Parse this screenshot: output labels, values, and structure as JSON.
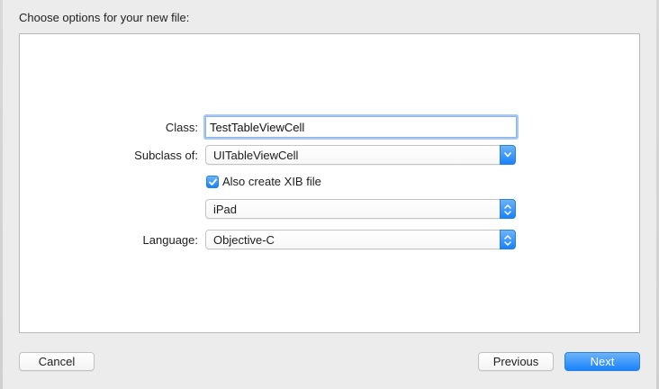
{
  "dialog": {
    "heading": "Choose options for your new file:"
  },
  "form": {
    "class_label": "Class:",
    "class_value": "TestTableViewCell",
    "subclass_label": "Subclass of:",
    "subclass_value": "UITableViewCell",
    "xib_checkbox_label": "Also create XIB file",
    "xib_checked": true,
    "device_value": "iPad",
    "language_label": "Language:",
    "language_value": "Objective-C"
  },
  "buttons": {
    "cancel": "Cancel",
    "previous": "Previous",
    "next": "Next"
  },
  "colors": {
    "accent": "#1a82fb",
    "focus_ring": "#a9c8f3",
    "window_bg": "#ececec",
    "panel_bg": "#ffffff"
  }
}
